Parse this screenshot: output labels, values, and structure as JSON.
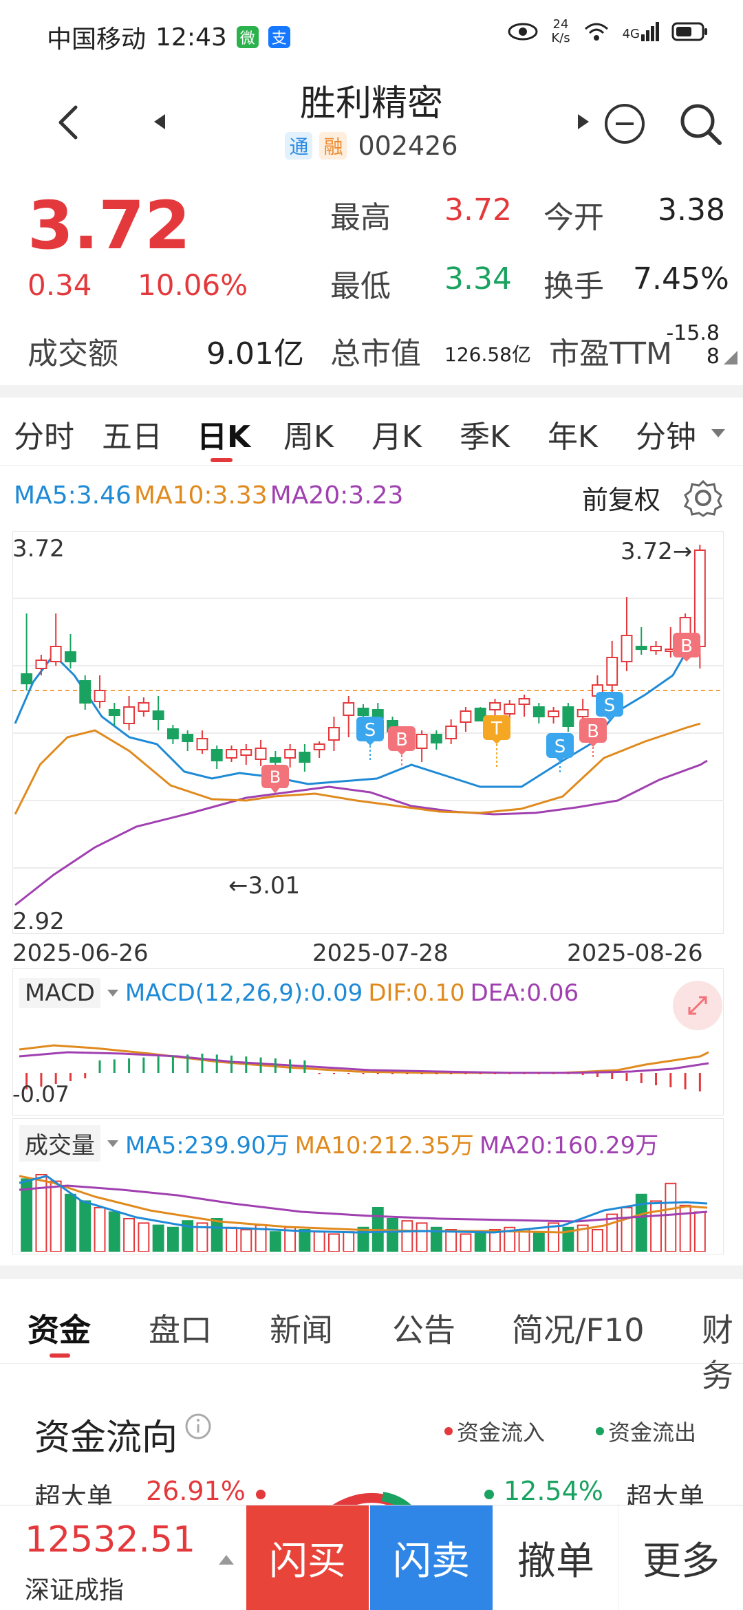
{
  "status_bar": {
    "carrier": "中国移动",
    "time": "12:43",
    "net_speed_value": "24",
    "net_speed_unit": "K/s",
    "signal": "4G",
    "wechat_chip": "微",
    "alipay_chip": "支"
  },
  "header": {
    "stock_name": "胜利精密",
    "tag1": "通",
    "tag2": "融",
    "stock_code": "002426"
  },
  "quote": {
    "price": "3.72",
    "change": "0.34",
    "change_pct": "10.06%",
    "high_label": "最高",
    "high_value": "3.72",
    "open_label": "今开",
    "open_value": "3.38",
    "low_label": "最低",
    "low_value": "3.34",
    "turnover_label": "换手",
    "turnover_value": "7.45%",
    "amount_label": "成交额",
    "amount_value": "9.01亿",
    "mktcap_label": "总市值",
    "mktcap_value": "126.58亿",
    "pe_label": "市盈TTM",
    "pe_value": "-15.88"
  },
  "kline_tabs": [
    "分时",
    "五日",
    "日K",
    "周K",
    "月K",
    "季K",
    "年K",
    "分钟"
  ],
  "kline_active": "日K",
  "ma_legend": {
    "ma5": "MA5:3.46",
    "ma10": "MA10:3.33",
    "ma20": "MA20:3.23",
    "adjust": "前复权"
  },
  "price_chart": {
    "top_label": "3.72",
    "bottom_label": "2.92",
    "high_marker": "3.72→",
    "low_marker": "←3.01",
    "dates": [
      "2025-06-26",
      "2025-07-28",
      "2025-08-26"
    ]
  },
  "macd": {
    "name": "MACD",
    "params": "MACD(12,26,9):0.09",
    "dif": "DIF:0.10",
    "dea": "DEA:0.06",
    "low_label": "-0.07"
  },
  "volume": {
    "name": "成交量",
    "ma5": "MA5:239.90万",
    "ma10": "MA10:212.35万",
    "ma20": "MA20:160.29万"
  },
  "colors": {
    "up": "#e4393c",
    "down": "#1aa260",
    "ma5": "#1e8ad6",
    "ma10": "#e08a1e",
    "ma20": "#a040b0"
  },
  "bottom_tabs": [
    "资金",
    "盘口",
    "新闻",
    "公告",
    "简况/F10",
    "财务"
  ],
  "bottom_tab_active": "资金",
  "capital_flow": {
    "title": "资金流向",
    "legend_in": "资金流入",
    "legend_out": "资金流出",
    "left_label": "超大单",
    "left_value": "26.91%",
    "right_value": "12.54%",
    "right_label": "超大单"
  },
  "bottom_bar": {
    "index_value": "12532.51",
    "index_name": "深证成指",
    "buy": "闪买",
    "sell": "闪卖",
    "cancel": "撤单",
    "more": "更多"
  }
}
